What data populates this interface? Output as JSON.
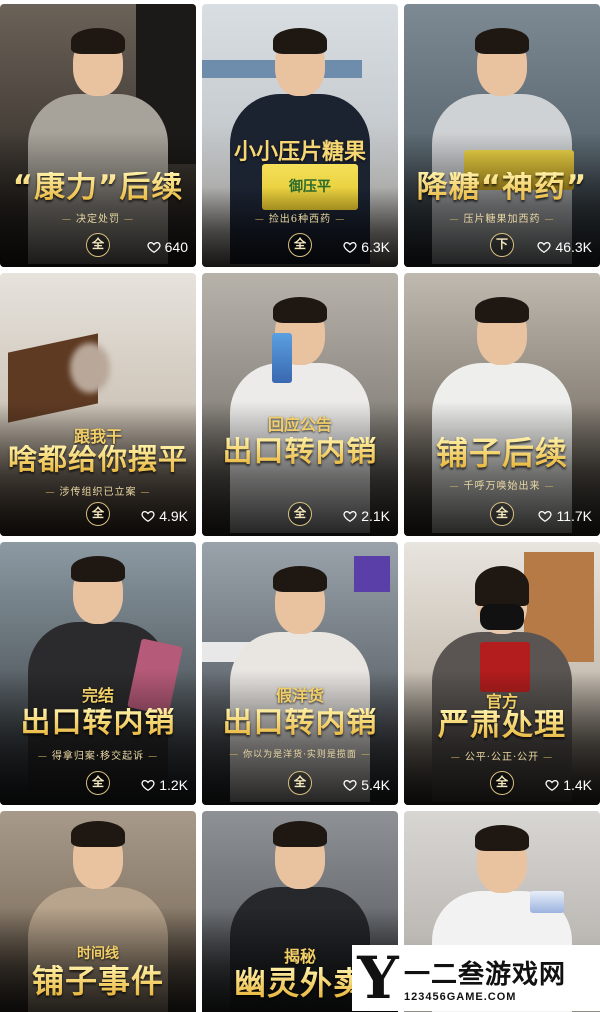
{
  "videos": [
    {
      "title": "“康力”后续",
      "subtitle": "决定处罚",
      "badge": "全",
      "likes": "640"
    },
    {
      "tag": "小小压片糖果",
      "product": "御压平",
      "subtitle": "捡出6种西药",
      "badge": "全",
      "likes": "6.3K"
    },
    {
      "title": "降糖“神药”",
      "subtitle": "压片糖果加西药",
      "badge": "下",
      "likes": "46.3K"
    },
    {
      "tag": "跟我干",
      "title": "啥都给你摆平",
      "subtitle": "涉传组织已立案",
      "badge": "全",
      "likes": "4.9K"
    },
    {
      "tag": "回应公告",
      "title": "出口转内销",
      "badge": "全",
      "likes": "2.1K"
    },
    {
      "title": "铺子后续",
      "subtitle": "千呼万唤始出来",
      "badge": "全",
      "likes": "11.7K"
    },
    {
      "tag": "完结",
      "title": "出口转内销",
      "subtitle": "得拿归案·移交起诉",
      "badge": "全",
      "likes": "1.2K"
    },
    {
      "tag": "假洋货",
      "title": "出口转内销",
      "subtitle": "你以为是洋货·实则是揽面",
      "badge": "全",
      "likes": "5.4K"
    },
    {
      "tag": "官方",
      "title": "严肃处理",
      "subtitle": "公平·公正·公开",
      "badge": "全",
      "likes": "1.4K"
    },
    {
      "tag": "时间线",
      "title": "铺子事件"
    },
    {
      "tag": "揭秘",
      "title": "幽灵外卖"
    },
    {}
  ],
  "watermark": {
    "letter": "Y",
    "name": "一二叁游戏网",
    "url": "123456GAME.COM"
  },
  "colors": {
    "title_gold": "#f7d774",
    "like_white": "#ffffff"
  },
  "icons": {
    "like": "heart-outline-icon"
  }
}
